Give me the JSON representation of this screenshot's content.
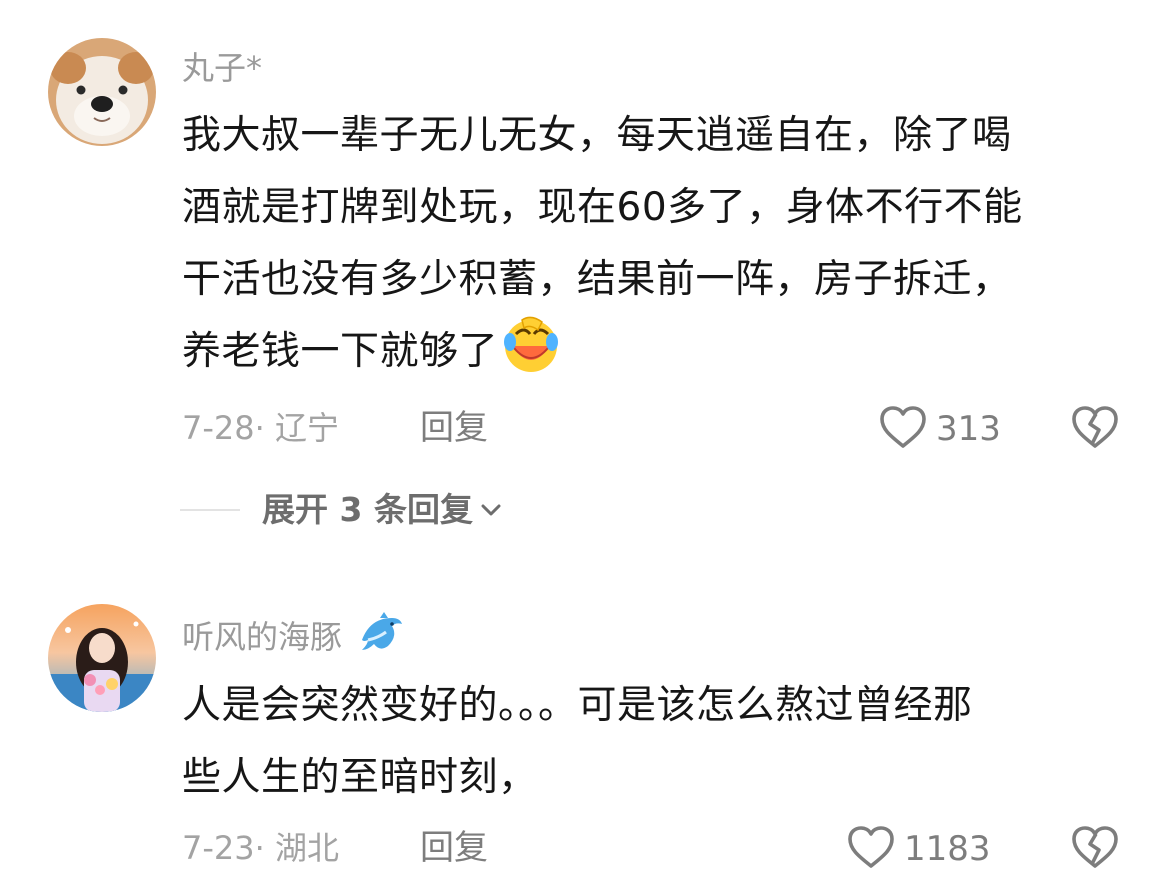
{
  "comments": [
    {
      "username": "丸子*",
      "lines": [
        "我大叔一辈子无儿无女，每天逍遥自在，除了喝",
        "酒就是打牌到处玩，现在60多了，身体不行不能",
        "干活也没有多少积蓄，结果前一阵，房子拆迁，",
        "养老钱一下就够了"
      ],
      "emoji": "laughing-tears-emoji",
      "meta": "7-28· 辽宁",
      "reply_label": "回复",
      "like_count": "313",
      "expand_label": "展开 3 条回复"
    },
    {
      "username": "听风的海豚",
      "username_emoji": "dolphin-emoji",
      "lines": [
        "人是会突然变好的。。。可是该怎么熬过曾经那",
        "些人生的至暗时刻，"
      ],
      "meta": "7-23· 湖北",
      "reply_label": "回复",
      "like_count": "1183"
    }
  ],
  "colors": {
    "text_primary": "#161616",
    "text_secondary": "#9a9a9a",
    "icon_gray": "#7d7d7d",
    "background": "#ffffff"
  }
}
